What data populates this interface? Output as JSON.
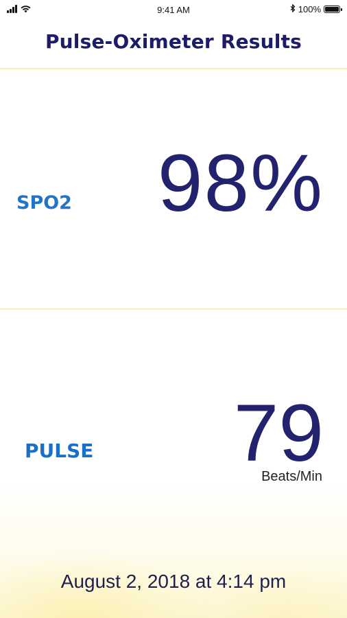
{
  "status_bar": {
    "time": "9:41 AM",
    "battery_percent": "100%",
    "battery_level": 1.0,
    "signal_bars": 4,
    "icons": [
      "signal-icon",
      "wifi-icon",
      "bluetooth-icon",
      "battery-icon"
    ]
  },
  "header": {
    "title": "Pulse-Oximeter Results"
  },
  "readings": {
    "spo2": {
      "label": "SPO2",
      "value": "98%"
    },
    "pulse": {
      "label": "PULSE",
      "value": "79",
      "unit": "Beats/Min"
    }
  },
  "footer": {
    "timestamp": "August 2, 2018 at 4:14 pm"
  },
  "colors": {
    "title": "#1c1c6b",
    "label": "#2174c8",
    "value": "#22226e",
    "divider": "#f7efb4",
    "glow": "#f9e88c"
  }
}
